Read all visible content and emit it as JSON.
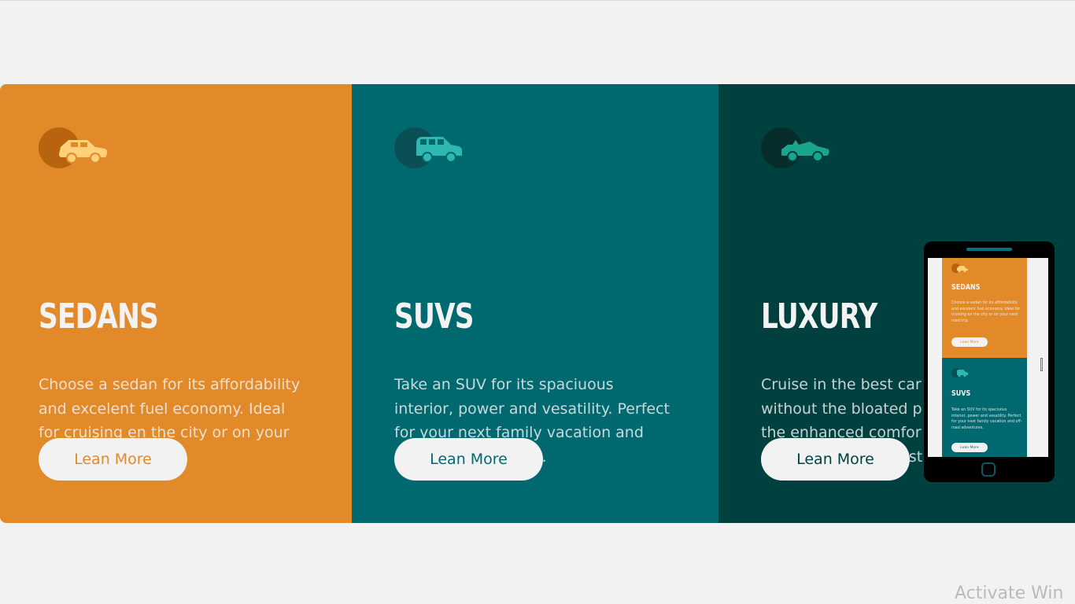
{
  "cards": [
    {
      "title": "SEDANS",
      "description": "Choose a sedan for its affordability and excelent fuel economy. Ideal for cruising en the city or on your next road trip.",
      "button_label": "Lean More",
      "icon": "sedan-car-icon",
      "background_color": "#e28a2a",
      "icon_color": "#ffd27a"
    },
    {
      "title": "SUVS",
      "description": "Take an SUV for its spaciuous interior, power and vesatility. Perfect for your next family vacation and off-road adventures.",
      "button_label": "Lean More",
      "icon": "suv-car-icon",
      "background_color": "#006970",
      "icon_color": "#2fb8b0"
    },
    {
      "title": "LUXURY",
      "description": "Cruise in the best car without the bloated p the enhanced comfor rental and arrive in st",
      "button_label": "Lean More",
      "icon": "convertible-car-icon",
      "background_color": "#004140",
      "icon_color": "#1aa58c"
    }
  ],
  "phone_preview": {
    "cards": [
      {
        "title": "SEDANS",
        "description": "Choose a sedan for its affordability and excelent fuel economy. Ideal for cruising en the city or on your next road trip.",
        "button_label": "Lean More"
      },
      {
        "title": "SUVS",
        "description": "Take an SUV for its spaciuous interior, power and vesatility. Perfect for your next family vacation and off-road adventures.",
        "button_label": "Lean More"
      }
    ]
  },
  "watermark": "Activate Win",
  "colors": {
    "page_background": "#f2f2f2",
    "button_background": "#f2f2f2",
    "text_light": "#f2f2f2"
  }
}
